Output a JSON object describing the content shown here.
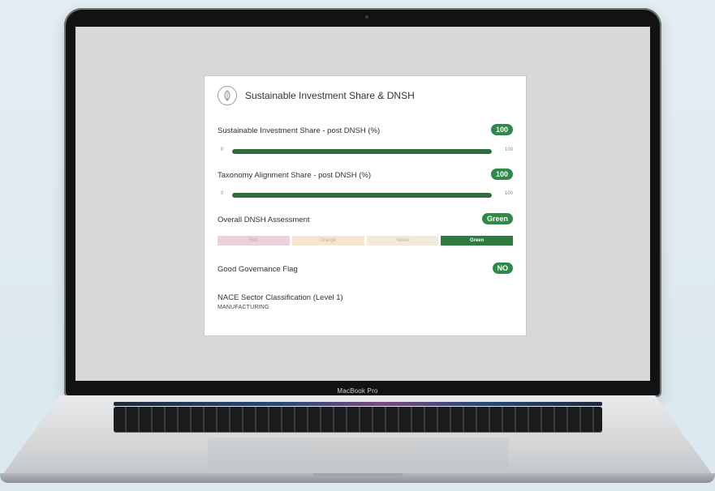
{
  "device": {
    "label": "MacBook Pro"
  },
  "card": {
    "title": "Sustainable Investment Share & DNSH",
    "icon": "leaf-icon",
    "sustainable_share": {
      "label": "Sustainable Investment Share - post DNSH (%)",
      "badge": "100",
      "min": "0",
      "max": "100",
      "value_fraction": 1.0
    },
    "taxonomy_share": {
      "label": "Taxonomy Alignment Share - post DNSH (%)",
      "badge": "100",
      "min": "0",
      "max": "100",
      "value_fraction": 1.0
    },
    "dnsh": {
      "label": "Overall DNSH Assessment",
      "badge": "Green",
      "scale": [
        "Red",
        "Orange",
        "Yellow",
        "Green"
      ],
      "selected": "Green"
    },
    "governance": {
      "label": "Good Governance Flag",
      "badge": "NO"
    },
    "nace": {
      "label": "NACE Sector Classification (Level 1)",
      "value": "MANUFACTURING"
    }
  },
  "colors": {
    "accent_green": "#2e8a46",
    "bar_fill": "#2e6e3e",
    "scale_red": "#ecd2da",
    "scale_orange": "#f6e5cf",
    "scale_yellow": "#f2ebdc",
    "scale_green": "#2e7a3f"
  }
}
